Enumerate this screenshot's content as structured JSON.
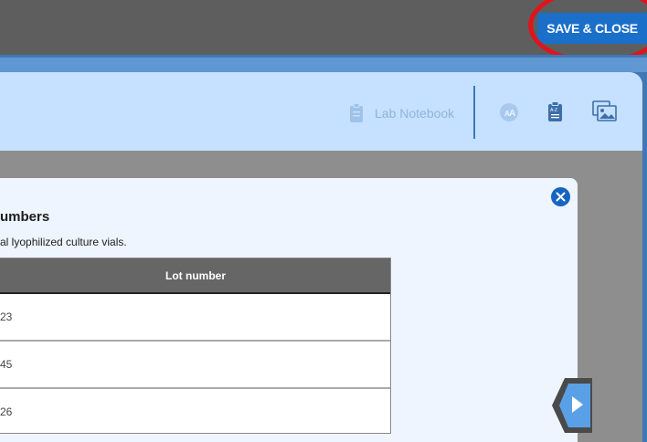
{
  "toolbar": {
    "save_close_label": "SAVE & CLOSE"
  },
  "header": {
    "lab_notebook_label": "Lab Notebook",
    "icons": [
      "clipboard-icon",
      "text-size-icon",
      "az-clipboard-icon",
      "gallery-icon"
    ]
  },
  "modal": {
    "title": "umbers",
    "description": "al lyophilized culture vials.",
    "table": {
      "column_header": "Lot number",
      "rows": [
        "23",
        "45",
        "26"
      ]
    }
  },
  "colors": {
    "accent": "#1a6fc8",
    "highlight_circle": "#e0141b",
    "header_panel": "#c6e0ff",
    "modal_bg": "#eef5ff"
  }
}
